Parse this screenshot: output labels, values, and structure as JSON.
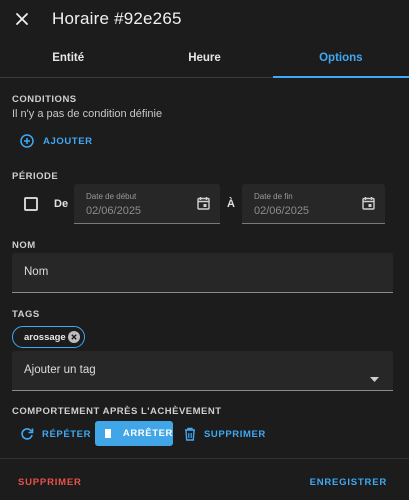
{
  "dialog": {
    "title": "Horaire #92e265"
  },
  "tabs": [
    {
      "label": "Entité"
    },
    {
      "label": "Heure"
    },
    {
      "label": "Options"
    }
  ],
  "conditions": {
    "label": "CONDITIONS",
    "empty_text": "Il n'y a pas de condition définie",
    "add_label": "AJOUTER"
  },
  "period": {
    "label": "PÉRIODE",
    "from_label": "De",
    "to_label": "À",
    "start": {
      "label": "Date de début",
      "value": "02/06/2025"
    },
    "end": {
      "label": "Date de fin",
      "value": "02/06/2025"
    }
  },
  "name": {
    "label": "NOM",
    "value": "Nom"
  },
  "tags": {
    "label": "TAGS",
    "chip": "arossage",
    "add_placeholder": "Ajouter un tag"
  },
  "completion": {
    "label": "COMPORTEMENT APRÈS L'ACHÈVEMENT",
    "repeat_label": "RÉPÉTER",
    "stop_label": "ARRÊTER",
    "delete_label": "SUPPRIMER"
  },
  "footer": {
    "delete_label": "SUPPRIMER",
    "save_label": "ENREGISTRER"
  },
  "colors": {
    "accent": "#3fa9f5",
    "danger": "#e8524a",
    "background": "#1c1c1c"
  }
}
